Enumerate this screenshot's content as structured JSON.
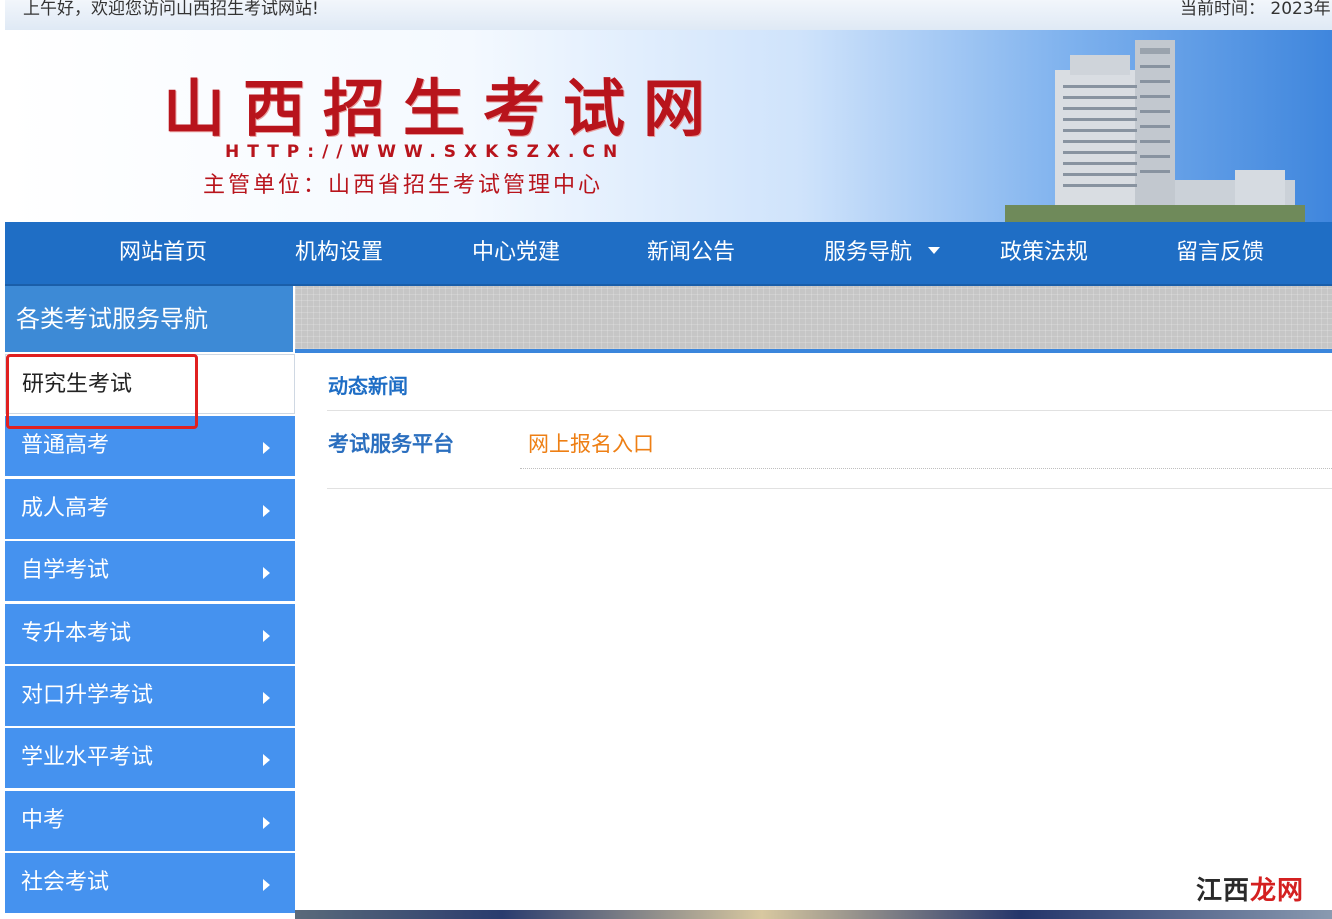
{
  "topbar": {
    "greeting": "上午好，欢迎您访问山西招生考试网站!",
    "time_label": "当前时间： 2023年"
  },
  "banner": {
    "site_title": "山西招生考试网",
    "url": "HTTP://WWW.SXKSZX.CN",
    "org": "主管单位：山西省招生考试管理中心"
  },
  "nav": {
    "items": [
      {
        "label": "网站首页"
      },
      {
        "label": "机构设置"
      },
      {
        "label": "中心党建"
      },
      {
        "label": "新闻公告"
      },
      {
        "label": "服务导航",
        "has_dropdown": true
      },
      {
        "label": "政策法规"
      },
      {
        "label": "留言反馈"
      }
    ]
  },
  "sidebar": {
    "title": "各类考试服务导航",
    "items": [
      {
        "label": "研究生考试",
        "active": true
      },
      {
        "label": "普通高考"
      },
      {
        "label": "成人高考"
      },
      {
        "label": "自学考试"
      },
      {
        "label": "专升本考试"
      },
      {
        "label": "对口升学考试"
      },
      {
        "label": "学业水平考试"
      },
      {
        "label": "中考"
      },
      {
        "label": "社会考试"
      }
    ]
  },
  "content": {
    "news_label": "动态新闻",
    "platform_label": "考试服务平台",
    "entry_link": "网上报名入口"
  },
  "watermark": {
    "part1": "江西",
    "part2": "龙网"
  },
  "colors": {
    "nav_bg": "#1f6ec5",
    "sidebar_item_bg": "#4592ef",
    "title_red": "#b8141c",
    "link_orange": "#ee7f14",
    "highlight_red": "#e02020"
  }
}
